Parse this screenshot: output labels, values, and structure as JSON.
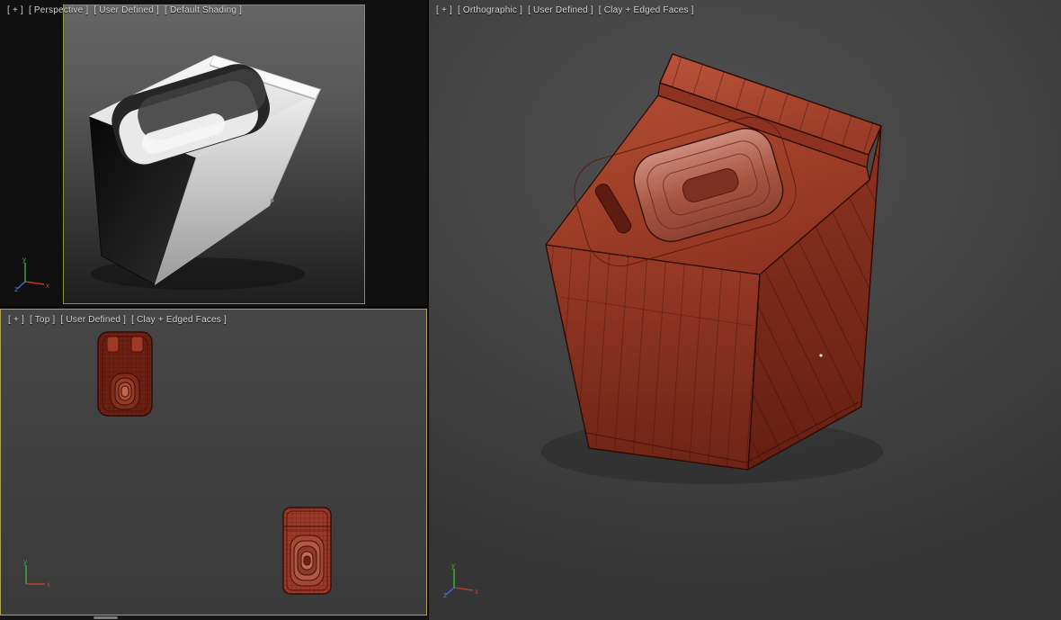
{
  "viewports": {
    "perspective": {
      "menu": "[ + ]",
      "name": "[ Perspective ]",
      "pov": "[ User Defined ]",
      "shading": "[ Default Shading ]"
    },
    "top": {
      "menu": "[ + ]",
      "name": "[ Top ]",
      "pov": "[ User Defined ]",
      "shading": "[ Clay + Edged Faces ]"
    },
    "orthographic": {
      "menu": "[ + ]",
      "name": "[ Orthographic ]",
      "pov": "[ User Defined ]",
      "shading": "[ Clay + Edged Faces ]"
    }
  },
  "axis_tripod": {
    "x": "x",
    "y": "y",
    "z": "z"
  },
  "colors": {
    "clay_red": "#9a3927",
    "clay_edge": "#2f0d07",
    "active_viewport_border": "#b1a14c",
    "safe_frame_border": "#8e8e46",
    "viewport_background": "#404040"
  }
}
